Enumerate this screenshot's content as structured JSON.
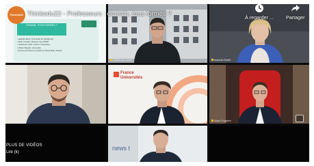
{
  "video": {
    "title": "Thinkedu22 - Professeurs : demain, tous formés ?",
    "channel_logo_text": "Thinkedu22"
  },
  "actions": {
    "watch_later": "À regarder ...",
    "share": "Partager"
  },
  "slide": {
    "header_line1": "DEMAIN, TOUS FORMÉS ?",
    "items": [
      "• Isabelle Barth, Université de Strasbourg",
      "• Alain Frugière, Réseau des INSPÉ",
      "• Guillaume Gellé, France Universités",
      "• Olivier Bayard, Université",
      "• Animé par Florent Lombard et Olivia Mijon Sultani"
    ]
  },
  "participants": [
    {
      "name": "Guillaume Gellé"
    },
    {
      "name": "Isabelle Barth"
    },
    {
      "name": "Alain Frugière"
    }
  ],
  "banners": {
    "france_universites_line1": "France",
    "france_universites_line2": "Universités",
    "news_tank": "news t"
  },
  "overlay": {
    "more_videos": "PLUS DE VIDÉOS",
    "watch_link": "Lire (k)"
  },
  "colors": {
    "accent_orange": "#e07a2a",
    "slide_teal": "#2fb9a0",
    "chair_red": "#c41e1e"
  }
}
